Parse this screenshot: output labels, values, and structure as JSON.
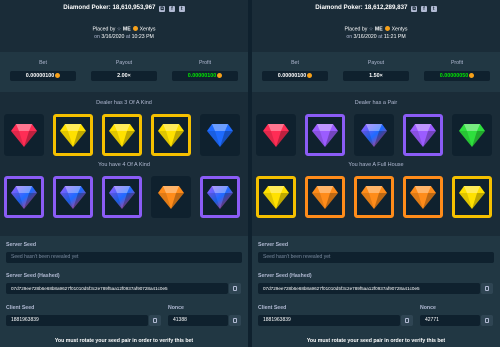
{
  "gem_colors": {
    "red": "#ff2d55",
    "yellow": "#ffe100",
    "blue": "#1e6bff",
    "purple": "#9b5cff",
    "green": "#2ee03d",
    "orange": "#ff8c1a",
    "rainbow": "#5b63ff"
  },
  "left": {
    "title": "Diamond Poker: 18,610,953,967",
    "placed_by_prefix": "Placed by",
    "star": "☆",
    "placed_by_me": "ME",
    "placed_by_user": "Xentys",
    "date_prefix": "on",
    "date": "3/16/2020",
    "time_prefix": "at",
    "time": "10:23 PM",
    "bet_label": "Bet",
    "bet_value": "0.00000100",
    "payout_label": "Payout",
    "payout_value": "2.00×",
    "profit_label": "Profit",
    "profit_value": "0.00000100",
    "dealer_result": "Dealer has 3 Of A Kind",
    "dealer_gems": [
      {
        "gem": "red",
        "highlight": "none"
      },
      {
        "gem": "yellow",
        "highlight": "yellow"
      },
      {
        "gem": "yellow",
        "highlight": "yellow"
      },
      {
        "gem": "yellow",
        "highlight": "yellow"
      },
      {
        "gem": "blue",
        "highlight": "none"
      }
    ],
    "player_result": "You have 4 Of A Kind",
    "player_gems": [
      {
        "gem": "rainbow",
        "highlight": "purple"
      },
      {
        "gem": "rainbow",
        "highlight": "purple"
      },
      {
        "gem": "rainbow",
        "highlight": "purple"
      },
      {
        "gem": "orange",
        "highlight": "none"
      },
      {
        "gem": "rainbow",
        "highlight": "purple"
      }
    ],
    "server_seed_label": "Server Seed",
    "server_seed_placeholder": "Seed hasn't been revealed yet",
    "server_seed_hashed_label": "Server Seed (Hashed)",
    "server_seed_hashed": "07d729ee728b6e68b8a9627f01010d5f3c2e789f5aa12f0937af90728a41c0e5",
    "client_seed_label": "Client Seed",
    "client_seed": "1881963839",
    "nonce_label": "Nonce",
    "nonce": "41388",
    "note": "You must rotate your seed pair in order to verify this bet"
  },
  "right": {
    "title": "Diamond Poker: 18,612,289,837",
    "placed_by_prefix": "Placed by",
    "star": "☆",
    "placed_by_me": "ME",
    "placed_by_user": "Xentys",
    "date_prefix": "on",
    "date": "3/16/2020",
    "time_prefix": "at",
    "time": "11:21 PM",
    "bet_label": "Bet",
    "bet_value": "0.00000100",
    "payout_label": "Payout",
    "payout_value": "1.50×",
    "profit_label": "Profit",
    "profit_value": "0.00000050",
    "dealer_result": "Dealer has a Pair",
    "dealer_gems": [
      {
        "gem": "red",
        "highlight": "none"
      },
      {
        "gem": "purple",
        "highlight": "purple"
      },
      {
        "gem": "rainbow",
        "highlight": "none"
      },
      {
        "gem": "purple",
        "highlight": "purple"
      },
      {
        "gem": "green",
        "highlight": "none"
      }
    ],
    "player_result": "You have A Full House",
    "player_gems": [
      {
        "gem": "yellow",
        "highlight": "yellow"
      },
      {
        "gem": "orange",
        "highlight": "orange"
      },
      {
        "gem": "orange",
        "highlight": "orange"
      },
      {
        "gem": "orange",
        "highlight": "orange"
      },
      {
        "gem": "yellow",
        "highlight": "yellow"
      }
    ],
    "server_seed_label": "Server Seed",
    "server_seed_placeholder": "Seed hasn't been revealed yet",
    "server_seed_hashed_label": "Server Seed (Hashed)",
    "server_seed_hashed": "07d729ee728b6e68b8a9627f01010d5f3c2e789f5aa12f0937af90728a41c0e5",
    "client_seed_label": "Client Seed",
    "client_seed": "1881963839",
    "nonce_label": "Nonce",
    "nonce": "42771",
    "note": "You must rotate your seed pair in order to verify this bet"
  }
}
